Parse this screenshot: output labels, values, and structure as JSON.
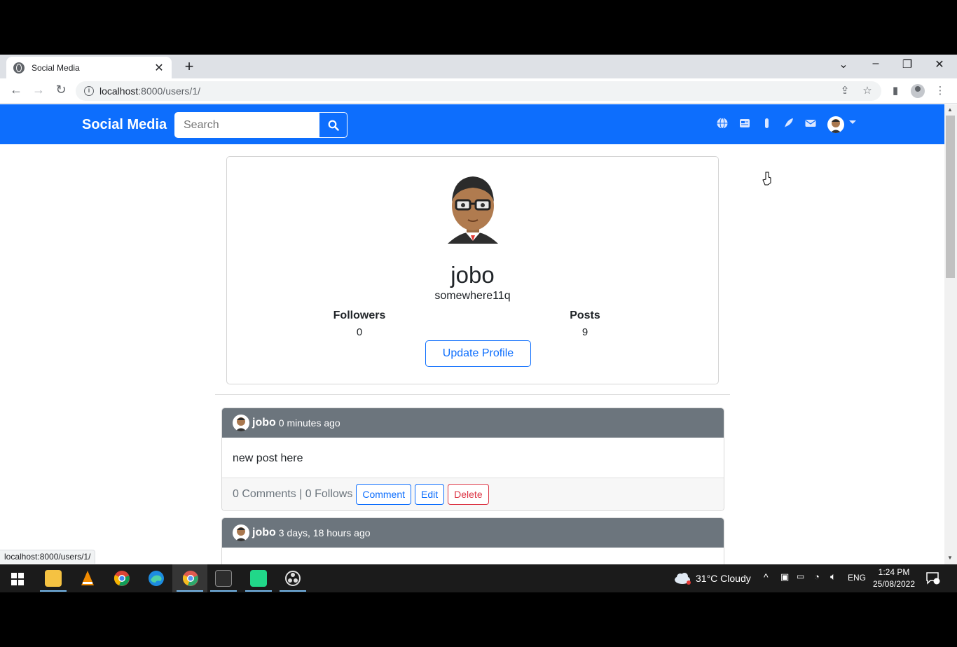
{
  "browser": {
    "tab_title": "Social Media",
    "tab_close": "✕",
    "new_tab": "+",
    "url_host": "localhost",
    "url_rest": ":8000/users/1/",
    "status_url": "localhost:8000/users/1/"
  },
  "app": {
    "brand": "Social Media",
    "search_placeholder": "Search"
  },
  "profile": {
    "username": "jobo",
    "location": "somewhere11q",
    "followers_label": "Followers",
    "followers_value": "0",
    "posts_label": "Posts",
    "posts_value": "9",
    "update_button": "Update Profile"
  },
  "posts": [
    {
      "author": "jobo",
      "time": "0 minutes ago",
      "body": "new post here",
      "meta": "0 Comments | 0 Follows",
      "comment_label": "Comment",
      "edit_label": "Edit",
      "delete_label": "Delete"
    },
    {
      "author": "jobo",
      "time": "3 days, 18 hours ago"
    }
  ],
  "taskbar": {
    "weather": "31°C  Cloudy",
    "language": "ENG",
    "time": "1:24 PM",
    "date": "25/08/2022"
  },
  "colors": {
    "primary": "#0d6efd",
    "secondary": "#6c757d",
    "danger": "#dc3545"
  }
}
